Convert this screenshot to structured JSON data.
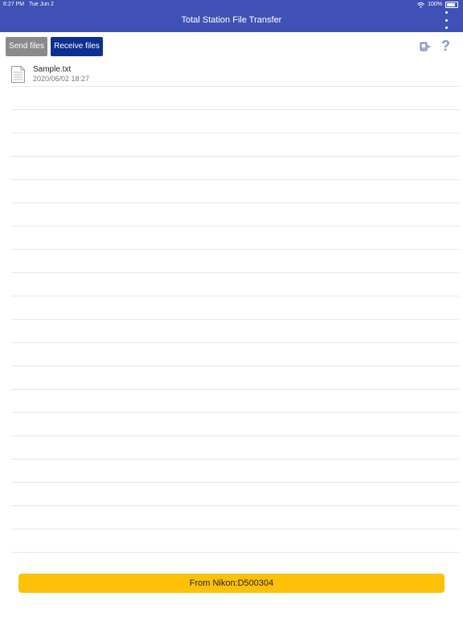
{
  "status_bar": {
    "time": "6:27 PM",
    "date": "Tue Jun 2",
    "battery": "100%"
  },
  "header": {
    "title": "Total Station File Transfer"
  },
  "toolbar": {
    "send_label": "Send files",
    "receive_label": "Receive files"
  },
  "files": [
    {
      "name": "Sample.txt",
      "date": "2020/06/02 18:27"
    }
  ],
  "bottom": {
    "button_label": "From Nikon:D500304"
  },
  "colors": {
    "header": "#3f51b5",
    "send": "#8a8a8a",
    "receive": "#0d2f8f",
    "bottom": "#ffc107"
  },
  "icons": {
    "menu": "more-vertical-icon",
    "transfer": "device-transfer-icon",
    "help": "help-icon",
    "file": "text-file-icon"
  },
  "help_glyph": "?"
}
